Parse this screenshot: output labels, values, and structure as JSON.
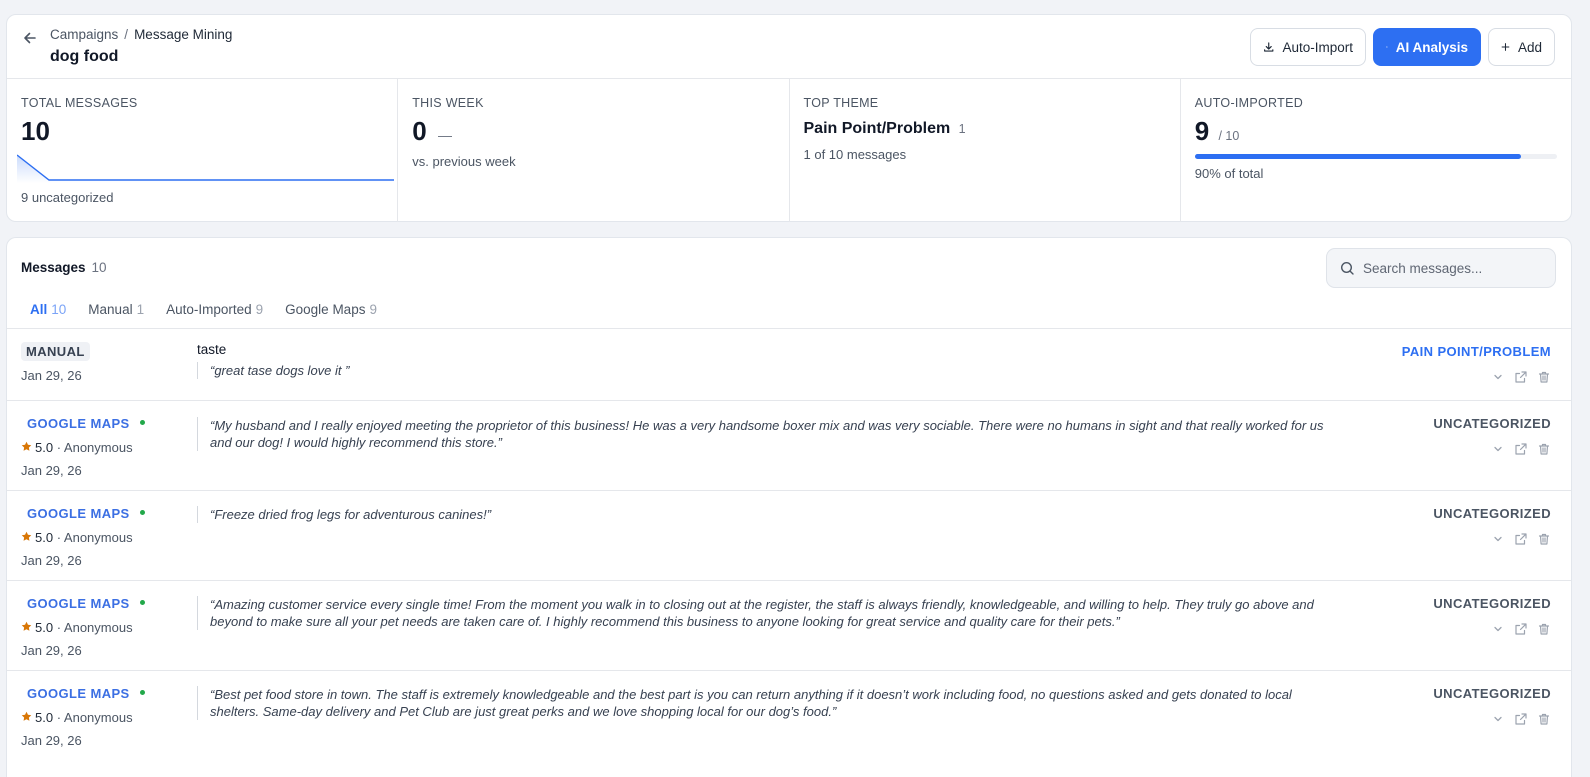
{
  "header": {
    "breadcrumb": [
      "Campaigns",
      "Message Mining"
    ],
    "separator": "/",
    "title": "dog food",
    "buttons": {
      "auto_import": "Auto-Import",
      "ai_analysis": "AI Analysis",
      "add": "Add"
    }
  },
  "stats": {
    "total": {
      "label": "TOTAL MESSAGES",
      "value": "10",
      "sub": "9 uncategorized"
    },
    "week": {
      "label": "THIS WEEK",
      "value": "0",
      "trend": "—",
      "sub": "vs. previous week"
    },
    "theme": {
      "label": "TOP THEME",
      "value": "Pain Point/Problem",
      "count": "1",
      "sub": "1 of 10 messages"
    },
    "auto": {
      "label": "AUTO-IMPORTED",
      "value": "9",
      "of": "/ 10",
      "sub": "90% of total",
      "fraction": 0.9
    }
  },
  "messages": {
    "title": "Messages",
    "count": "10",
    "search_placeholder": "Search messages...",
    "tabs": [
      {
        "label": "All",
        "count": "10"
      },
      {
        "label": "Manual",
        "count": "1"
      },
      {
        "label": "Auto-Imported",
        "count": "9"
      },
      {
        "label": "Google Maps",
        "count": "9"
      }
    ],
    "rows": [
      {
        "source": "MANUAL",
        "date": "Jan 29, 26",
        "title": "taste",
        "quote": "“great tase dogs love it ”",
        "category": "PAIN POINT/PROBLEM"
      },
      {
        "source": "GOOGLE MAPS",
        "rating": "5.0",
        "author": "· Anonymous",
        "date": "Jan 29, 26",
        "quote": "“My husband and I really enjoyed meeting the proprietor of this business! He was a very handsome boxer mix and was very sociable. There were no humans in sight and that really worked for us and our dog! I would highly recommend this store.”",
        "category": "UNCATEGORIZED"
      },
      {
        "source": "GOOGLE MAPS",
        "rating": "5.0",
        "author": "· Anonymous",
        "date": "Jan 29, 26",
        "quote": "“Freeze dried frog legs for adventurous canines!”",
        "category": "UNCATEGORIZED"
      },
      {
        "source": "GOOGLE MAPS",
        "rating": "5.0",
        "author": "· Anonymous",
        "date": "Jan 29, 26",
        "quote": "“Amazing customer service every single time! From the moment you walk in to closing out at the register, the staff is always friendly, knowledgeable, and willing to help. They truly go above and beyond to make sure all your pet needs are taken care of. I highly recommend this business to anyone looking for great service and quality care for their pets.”",
        "category": "UNCATEGORIZED"
      },
      {
        "source": "GOOGLE MAPS",
        "rating": "5.0",
        "author": "· Anonymous",
        "date": "Jan 29, 26",
        "quote": "“Best pet food store in town. The staff is extremely knowledgeable and the best part is you can return anything if it doesn’t work including food, no questions asked and gets donated to local shelters. Same-day delivery and Pet Club are just great perks and we love shopping local for our dog’s food.”",
        "category": "UNCATEGORIZED"
      }
    ]
  },
  "icons": {
    "back": "arrow-left-icon",
    "import": "download-icon",
    "ai": "brain-icon",
    "add": "plus-icon",
    "search": "search-icon",
    "star": "star-icon",
    "expand": "chevron-down-icon",
    "open": "external-link-icon",
    "delete": "trash-icon"
  },
  "colors": {
    "accent": "#2d6ff2",
    "star": "#d97706",
    "google_dot": "#22a84a",
    "text_muted": "#4b5563"
  }
}
